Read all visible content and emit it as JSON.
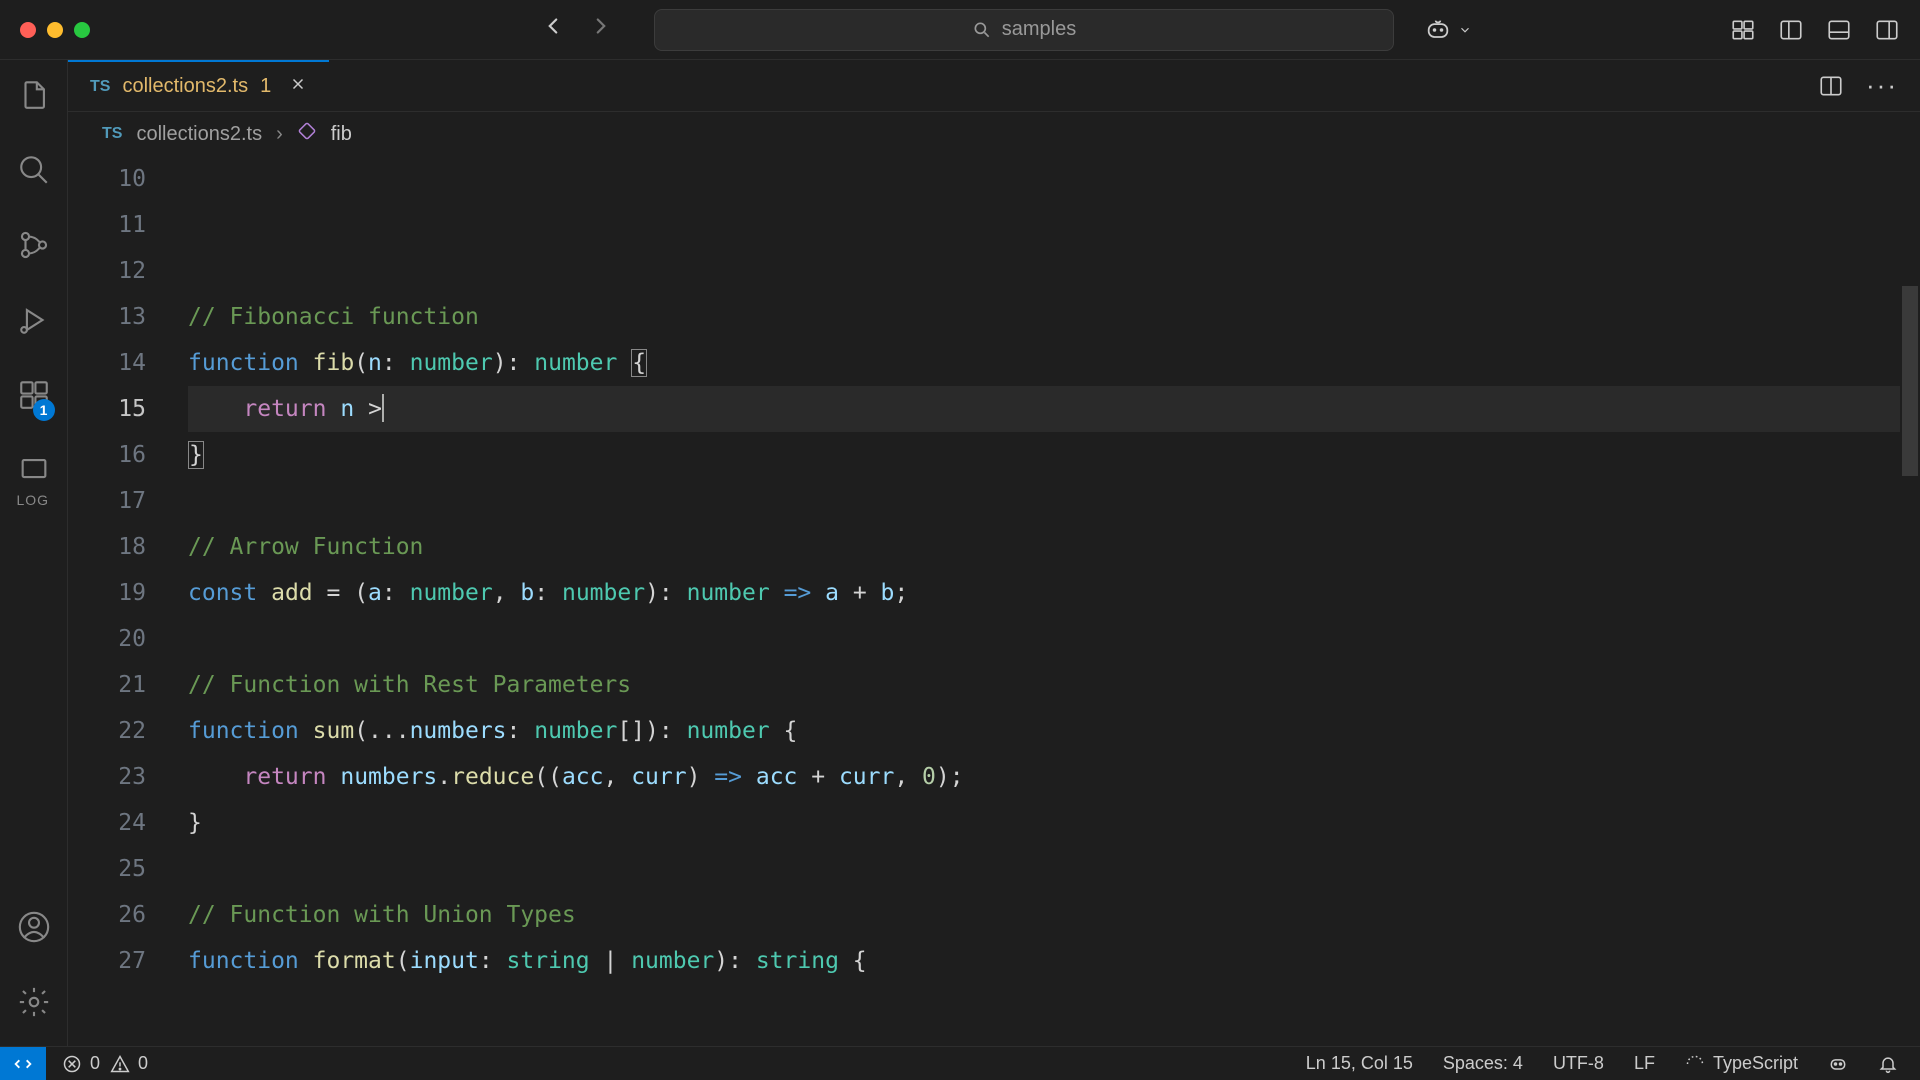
{
  "titlebar": {
    "search_placeholder": "samples"
  },
  "activity": {
    "extensions_badge": "1",
    "log_label": "LOG"
  },
  "tab": {
    "icon_label": "TS",
    "filename": "collections2.ts",
    "problem_count": "1"
  },
  "tab_actions": {
    "ellipsis": "···"
  },
  "breadcrumb": {
    "icon_label": "TS",
    "file": "collections2.ts",
    "symbol": "fib"
  },
  "code": {
    "lines": [
      {
        "n": "10",
        "tokens": []
      },
      {
        "n": "11",
        "tokens": []
      },
      {
        "n": "12",
        "tokens": []
      },
      {
        "n": "13",
        "tokens": [
          {
            "t": "// Fibonacci function",
            "c": "tok-comment"
          }
        ]
      },
      {
        "n": "14",
        "tokens": [
          {
            "t": "function",
            "c": "tok-keyword-decl"
          },
          {
            "t": " ",
            "c": ""
          },
          {
            "t": "fib",
            "c": "tok-fn"
          },
          {
            "t": "(",
            "c": "tok-punct"
          },
          {
            "t": "n",
            "c": "tok-param"
          },
          {
            "t": ": ",
            "c": "tok-punct"
          },
          {
            "t": "number",
            "c": "tok-type"
          },
          {
            "t": "): ",
            "c": "tok-punct"
          },
          {
            "t": "number",
            "c": "tok-type"
          },
          {
            "t": " ",
            "c": ""
          },
          {
            "t": "{",
            "c": "tok-punct tok-bracket-match"
          }
        ]
      },
      {
        "n": "15",
        "current": true,
        "tokens": [
          {
            "t": "    ",
            "c": ""
          },
          {
            "t": "return",
            "c": "tok-control"
          },
          {
            "t": " ",
            "c": ""
          },
          {
            "t": "n",
            "c": "tok-var"
          },
          {
            "t": " ",
            "c": ""
          },
          {
            "t": ">",
            "c": "tok-op"
          },
          {
            "cursor": true
          }
        ]
      },
      {
        "n": "16",
        "tokens": [
          {
            "t": "}",
            "c": "tok-punct tok-bracket-match"
          }
        ]
      },
      {
        "n": "17",
        "tokens": []
      },
      {
        "n": "18",
        "tokens": [
          {
            "t": "// Arrow Function",
            "c": "tok-comment"
          }
        ]
      },
      {
        "n": "19",
        "tokens": [
          {
            "t": "const",
            "c": "tok-keyword-decl"
          },
          {
            "t": " ",
            "c": ""
          },
          {
            "t": "add",
            "c": "tok-fn"
          },
          {
            "t": " = (",
            "c": "tok-punct"
          },
          {
            "t": "a",
            "c": "tok-param"
          },
          {
            "t": ": ",
            "c": "tok-punct"
          },
          {
            "t": "number",
            "c": "tok-type"
          },
          {
            "t": ", ",
            "c": "tok-punct"
          },
          {
            "t": "b",
            "c": "tok-param"
          },
          {
            "t": ": ",
            "c": "tok-punct"
          },
          {
            "t": "number",
            "c": "tok-type"
          },
          {
            "t": "): ",
            "c": "tok-punct"
          },
          {
            "t": "number",
            "c": "tok-type"
          },
          {
            "t": " ",
            "c": ""
          },
          {
            "t": "=>",
            "c": "tok-keyword-decl"
          },
          {
            "t": " ",
            "c": ""
          },
          {
            "t": "a",
            "c": "tok-var"
          },
          {
            "t": " + ",
            "c": "tok-op"
          },
          {
            "t": "b",
            "c": "tok-var"
          },
          {
            "t": ";",
            "c": "tok-punct"
          }
        ]
      },
      {
        "n": "20",
        "tokens": []
      },
      {
        "n": "21",
        "tokens": [
          {
            "t": "// Function with Rest Parameters",
            "c": "tok-comment"
          }
        ]
      },
      {
        "n": "22",
        "tokens": [
          {
            "t": "function",
            "c": "tok-keyword-decl"
          },
          {
            "t": " ",
            "c": ""
          },
          {
            "t": "sum",
            "c": "tok-fn"
          },
          {
            "t": "(...",
            "c": "tok-punct"
          },
          {
            "t": "numbers",
            "c": "tok-param"
          },
          {
            "t": ": ",
            "c": "tok-punct"
          },
          {
            "t": "number",
            "c": "tok-type"
          },
          {
            "t": "[]): ",
            "c": "tok-punct"
          },
          {
            "t": "number",
            "c": "tok-type"
          },
          {
            "t": " {",
            "c": "tok-punct"
          }
        ]
      },
      {
        "n": "23",
        "tokens": [
          {
            "t": "    ",
            "c": ""
          },
          {
            "t": "return",
            "c": "tok-control"
          },
          {
            "t": " ",
            "c": ""
          },
          {
            "t": "numbers",
            "c": "tok-var"
          },
          {
            "t": ".",
            "c": "tok-punct"
          },
          {
            "t": "reduce",
            "c": "tok-fn"
          },
          {
            "t": "((",
            "c": "tok-punct"
          },
          {
            "t": "acc",
            "c": "tok-param"
          },
          {
            "t": ", ",
            "c": "tok-punct"
          },
          {
            "t": "curr",
            "c": "tok-param"
          },
          {
            "t": ") ",
            "c": "tok-punct"
          },
          {
            "t": "=>",
            "c": "tok-keyword-decl"
          },
          {
            "t": " ",
            "c": ""
          },
          {
            "t": "acc",
            "c": "tok-var"
          },
          {
            "t": " + ",
            "c": "tok-op"
          },
          {
            "t": "curr",
            "c": "tok-var"
          },
          {
            "t": ", ",
            "c": "tok-punct"
          },
          {
            "t": "0",
            "c": "tok-num"
          },
          {
            "t": ");",
            "c": "tok-punct"
          }
        ]
      },
      {
        "n": "24",
        "tokens": [
          {
            "t": "}",
            "c": "tok-punct"
          }
        ]
      },
      {
        "n": "25",
        "tokens": []
      },
      {
        "n": "26",
        "tokens": [
          {
            "t": "// Function with Union Types",
            "c": "tok-comment"
          }
        ]
      },
      {
        "n": "27",
        "tokens": [
          {
            "t": "function",
            "c": "tok-keyword-decl"
          },
          {
            "t": " ",
            "c": ""
          },
          {
            "t": "format",
            "c": "tok-fn"
          },
          {
            "t": "(",
            "c": "tok-punct"
          },
          {
            "t": "input",
            "c": "tok-param"
          },
          {
            "t": ": ",
            "c": "tok-punct"
          },
          {
            "t": "string",
            "c": "tok-type"
          },
          {
            "t": " | ",
            "c": "tok-punct"
          },
          {
            "t": "number",
            "c": "tok-type"
          },
          {
            "t": "): ",
            "c": "tok-punct"
          },
          {
            "t": "string",
            "c": "tok-type"
          },
          {
            "t": " {",
            "c": "tok-punct"
          }
        ]
      }
    ]
  },
  "status": {
    "errors": "0",
    "warnings": "0",
    "cursor": "Ln 15, Col 15",
    "indent": "Spaces: 4",
    "encoding": "UTF-8",
    "eol": "LF",
    "language": "TypeScript"
  }
}
